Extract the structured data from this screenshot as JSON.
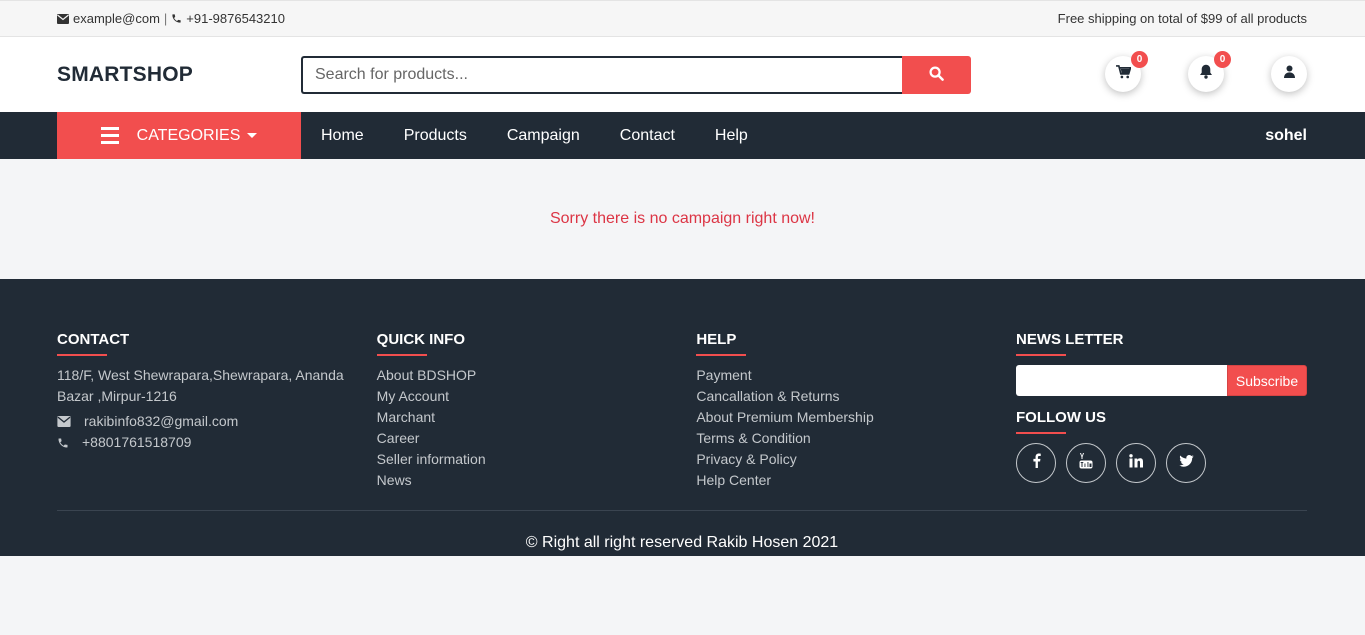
{
  "topbar": {
    "email": "example@com",
    "separator": "|",
    "phone": "+91-9876543210",
    "shipping": "Free shipping on total of $99 of all products"
  },
  "header": {
    "brand": "SMARTSHOP",
    "search_placeholder": "Search for products...",
    "cart_count": "0",
    "notif_count": "0"
  },
  "nav": {
    "categories_label": "CATEGORIES",
    "items": [
      "Home",
      "Products",
      "Campaign",
      "Contact",
      "Help"
    ],
    "user": "sohel"
  },
  "main": {
    "notice": "Sorry there is no campaign right now!"
  },
  "footer": {
    "contact": {
      "title": "CONTACT",
      "address": "118/F, West Shewrapara,Shewrapara, Ananda Bazar ,Mirpur-1216",
      "email": "rakibinfo832@gmail.com",
      "phone": "+8801761518709"
    },
    "quick_info": {
      "title": "QUICK INFO",
      "links": [
        "About BDSHOP",
        "My Account",
        "Marchant",
        "Career",
        "Seller information",
        "News"
      ]
    },
    "help": {
      "title": "HELP",
      "links": [
        "Payment",
        "Cancallation & Returns",
        "About Premium Membership",
        "Terms & Condition",
        "Privacy & Policy",
        "Help Center"
      ]
    },
    "newsletter": {
      "title": "NEWS LETTER",
      "subscribe_label": "Subscribe",
      "follow_title": "FOLLOW US",
      "socials": [
        "facebook-icon",
        "youtube-icon",
        "linkedin-icon",
        "twitter-icon"
      ]
    },
    "copyright": "© Right all right reserved Rakib Hosen 2021"
  },
  "colors": {
    "accent": "#f24e4e",
    "dark": "#212b36",
    "notice": "#dc3545"
  }
}
